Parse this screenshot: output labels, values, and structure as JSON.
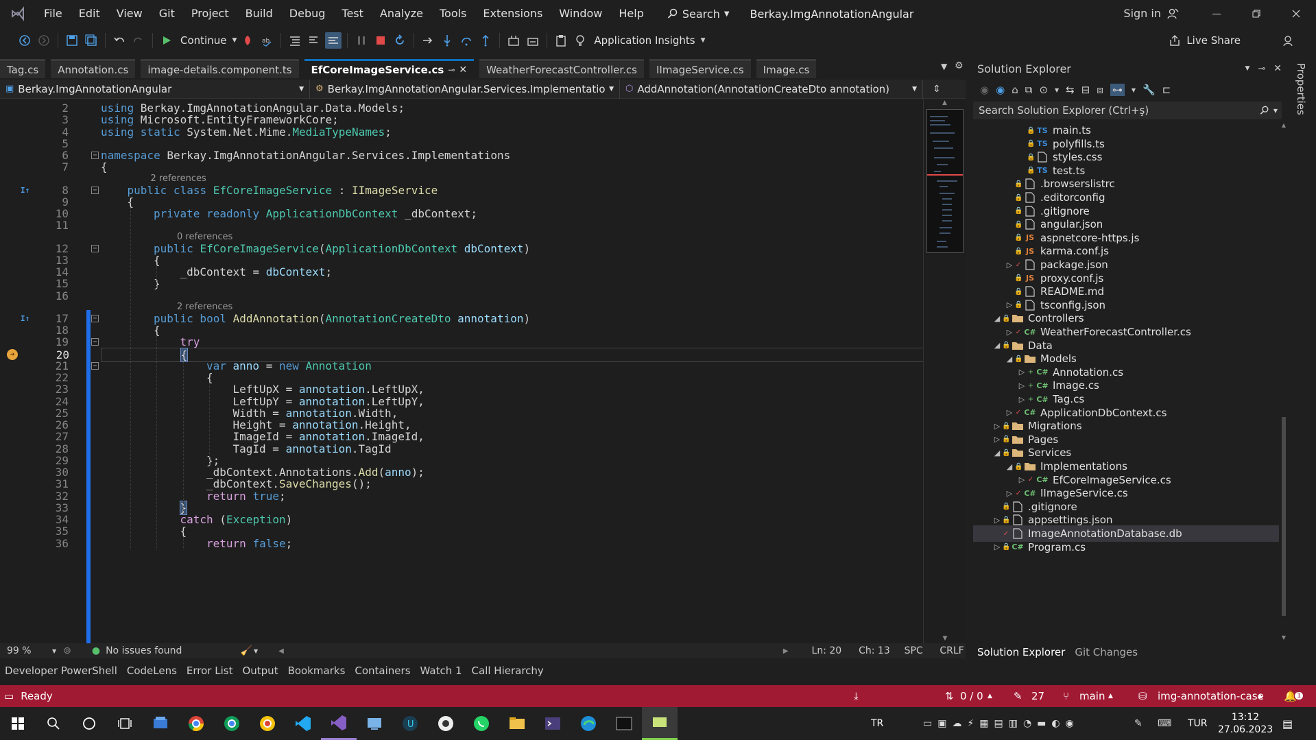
{
  "menubar": {
    "items": [
      "File",
      "Edit",
      "View",
      "Git",
      "Project",
      "Build",
      "Debug",
      "Test",
      "Analyze",
      "Tools",
      "Extensions",
      "Window",
      "Help"
    ],
    "search_label": "Search",
    "solution_name": "Berkay.ImgAnnotationAngular",
    "signin_label": "Sign in"
  },
  "toolbar": {
    "continue_label": "Continue",
    "app_insights_label": "Application Insights",
    "live_share_label": "Live Share"
  },
  "tabs": [
    {
      "label": "Tag.cs",
      "active": false
    },
    {
      "label": "Annotation.cs",
      "active": false
    },
    {
      "label": "image-details.component.ts",
      "active": false
    },
    {
      "label": "EfCoreImageService.cs",
      "active": true
    },
    {
      "label": "WeatherForecastController.cs",
      "active": false
    },
    {
      "label": "IImageService.cs",
      "active": false
    },
    {
      "label": "Image.cs",
      "active": false
    }
  ],
  "navbar": {
    "project": "Berkay.ImgAnnotationAngular",
    "type": "Berkay.ImgAnnotationAngular.Services.Implementations.EfCc",
    "member": "AddAnnotation(AnnotationCreateDto annotation)"
  },
  "editor": {
    "current_line": 20,
    "lines": [
      {
        "n": 2,
        "indent": 0,
        "tokens": [
          [
            "kw",
            "using "
          ],
          [
            "ns",
            "Berkay.ImgAnnotationAngular.Data.Models;"
          ]
        ]
      },
      {
        "n": 3,
        "indent": 0,
        "tokens": [
          [
            "kw",
            "using "
          ],
          [
            "ns",
            "Microsoft.EntityFrameworkCore;"
          ]
        ]
      },
      {
        "n": 4,
        "indent": 0,
        "tokens": [
          [
            "kw",
            "using static "
          ],
          [
            "ns",
            "System.Net.Mime."
          ],
          [
            "ty",
            "MediaTypeNames"
          ],
          [
            "pl",
            ";"
          ]
        ]
      },
      {
        "n": 5,
        "indent": 0,
        "tokens": []
      },
      {
        "n": 6,
        "indent": 0,
        "tokens": [
          [
            "kw",
            "namespace "
          ],
          [
            "ns",
            "Berkay.ImgAnnotationAngular.Services.Implementations"
          ]
        ]
      },
      {
        "n": 7,
        "indent": 0,
        "tokens": [
          [
            "pl",
            "{"
          ]
        ]
      },
      {
        "n": 8,
        "indent": 1,
        "lens": "2 references",
        "tokens": [
          [
            "kw",
            "public class "
          ],
          [
            "ty",
            "EfCoreImageService"
          ],
          [
            "pl",
            " : "
          ],
          [
            "fn",
            "IImageService"
          ]
        ]
      },
      {
        "n": 9,
        "indent": 1,
        "tokens": [
          [
            "pl",
            "{"
          ]
        ]
      },
      {
        "n": 10,
        "indent": 2,
        "tokens": [
          [
            "kw",
            "private readonly "
          ],
          [
            "ty",
            "ApplicationDbContext"
          ],
          [
            "pl",
            " _dbContext;"
          ]
        ]
      },
      {
        "n": 11,
        "indent": 0,
        "tokens": []
      },
      {
        "n": 12,
        "indent": 2,
        "lens": "0 references",
        "tokens": [
          [
            "kw",
            "public "
          ],
          [
            "ty",
            "EfCoreImageService"
          ],
          [
            "pl",
            "("
          ],
          [
            "ty",
            "ApplicationDbContext"
          ],
          [
            "pl",
            " "
          ],
          [
            "pa",
            "dbContext"
          ],
          [
            "pl",
            ")"
          ]
        ]
      },
      {
        "n": 13,
        "indent": 2,
        "tokens": [
          [
            "pl",
            "{"
          ]
        ]
      },
      {
        "n": 14,
        "indent": 3,
        "tokens": [
          [
            "pl",
            "_dbContext = "
          ],
          [
            "pa",
            "dbContext"
          ],
          [
            "pl",
            ";"
          ]
        ]
      },
      {
        "n": 15,
        "indent": 2,
        "tokens": [
          [
            "pl",
            "}"
          ]
        ]
      },
      {
        "n": 16,
        "indent": 0,
        "tokens": []
      },
      {
        "n": 17,
        "indent": 2,
        "lens": "2 references",
        "tokens": [
          [
            "kw",
            "public bool "
          ],
          [
            "fn",
            "AddAnnotation"
          ],
          [
            "pl",
            "("
          ],
          [
            "ty",
            "AnnotationCreateDto"
          ],
          [
            "pl",
            " "
          ],
          [
            "pa",
            "annotation"
          ],
          [
            "pl",
            ")"
          ]
        ]
      },
      {
        "n": 18,
        "indent": 2,
        "tokens": [
          [
            "pl",
            "{"
          ]
        ]
      },
      {
        "n": 19,
        "indent": 3,
        "tokens": [
          [
            "ctl",
            "try"
          ]
        ]
      },
      {
        "n": 20,
        "indent": 3,
        "tokens": [
          [
            "pl",
            "{"
          ]
        ]
      },
      {
        "n": 21,
        "indent": 4,
        "tokens": [
          [
            "kw",
            "var "
          ],
          [
            "pa",
            "anno"
          ],
          [
            "pl",
            " = "
          ],
          [
            "kw",
            "new "
          ],
          [
            "ty",
            "Annotation"
          ]
        ]
      },
      {
        "n": 22,
        "indent": 4,
        "tokens": [
          [
            "pl",
            "{"
          ]
        ]
      },
      {
        "n": 23,
        "indent": 5,
        "tokens": [
          [
            "pl",
            "LeftUpX = "
          ],
          [
            "pa",
            "annotation"
          ],
          [
            "pl",
            ".LeftUpX,"
          ]
        ]
      },
      {
        "n": 24,
        "indent": 5,
        "tokens": [
          [
            "pl",
            "LeftUpY = "
          ],
          [
            "pa",
            "annotation"
          ],
          [
            "pl",
            ".LeftUpY,"
          ]
        ]
      },
      {
        "n": 25,
        "indent": 5,
        "tokens": [
          [
            "pl",
            "Width = "
          ],
          [
            "pa",
            "annotation"
          ],
          [
            "pl",
            ".Width,"
          ]
        ]
      },
      {
        "n": 26,
        "indent": 5,
        "tokens": [
          [
            "pl",
            "Height = "
          ],
          [
            "pa",
            "annotation"
          ],
          [
            "pl",
            ".Height,"
          ]
        ]
      },
      {
        "n": 27,
        "indent": 5,
        "tokens": [
          [
            "pl",
            "ImageId = "
          ],
          [
            "pa",
            "annotation"
          ],
          [
            "pl",
            ".ImageId,"
          ]
        ]
      },
      {
        "n": 28,
        "indent": 5,
        "tokens": [
          [
            "pl",
            "TagId = "
          ],
          [
            "pa",
            "annotation"
          ],
          [
            "pl",
            ".TagId"
          ]
        ]
      },
      {
        "n": 29,
        "indent": 4,
        "tokens": [
          [
            "pl",
            "};"
          ]
        ]
      },
      {
        "n": 30,
        "indent": 4,
        "tokens": [
          [
            "pl",
            "_dbContext.Annotations."
          ],
          [
            "fn",
            "Add"
          ],
          [
            "pl",
            "("
          ],
          [
            "pa",
            "anno"
          ],
          [
            "pl",
            ");"
          ]
        ]
      },
      {
        "n": 31,
        "indent": 4,
        "tokens": [
          [
            "pl",
            "_dbContext."
          ],
          [
            "fn",
            "SaveChanges"
          ],
          [
            "pl",
            "();"
          ]
        ]
      },
      {
        "n": 32,
        "indent": 4,
        "tokens": [
          [
            "ctl",
            "return "
          ],
          [
            "kw",
            "true"
          ],
          [
            "pl",
            ";"
          ]
        ]
      },
      {
        "n": 33,
        "indent": 3,
        "tokens": [
          [
            "pl",
            "}"
          ]
        ]
      },
      {
        "n": 34,
        "indent": 3,
        "tokens": [
          [
            "ctl",
            "catch "
          ],
          [
            "pl",
            "("
          ],
          [
            "ty",
            "Exception"
          ],
          [
            "pl",
            ")"
          ]
        ]
      },
      {
        "n": 35,
        "indent": 3,
        "tokens": [
          [
            "pl",
            "{"
          ]
        ]
      },
      {
        "n": 36,
        "indent": 4,
        "tokens": [
          [
            "ctl",
            "return "
          ],
          [
            "kw",
            "false"
          ],
          [
            "pl",
            ";"
          ]
        ]
      }
    ]
  },
  "statusline": {
    "zoom": "99 %",
    "issues": "No issues found",
    "line": "Ln: 20",
    "col": "Ch: 13",
    "spacing": "SPC",
    "eol": "CRLF"
  },
  "bottom_tabs": [
    "Developer PowerShell",
    "CodeLens",
    "Error List",
    "Output",
    "Bookmarks",
    "Containers",
    "Watch 1",
    "Call Hierarchy"
  ],
  "statusbar": {
    "ready": "Ready",
    "updown": "0 / 0",
    "pencil_count": "27",
    "branch": "main",
    "repo": "img-annotation-case",
    "notifications": "1"
  },
  "solution_explorer": {
    "title": "Solution Explorer",
    "search_placeholder": "Search Solution Explorer (Ctrl+ş)",
    "tree": [
      {
        "label": "main.ts",
        "depth": 4,
        "expand": "",
        "icon": "TS",
        "iconColor": "#3b8ede"
      },
      {
        "label": "polyfills.ts",
        "depth": 4,
        "expand": "",
        "icon": "TS",
        "iconColor": "#3b8ede"
      },
      {
        "label": "styles.css",
        "depth": 4,
        "expand": "",
        "icon": "css",
        "iconColor": "#c8503c"
      },
      {
        "label": "test.ts",
        "depth": 4,
        "expand": "",
        "icon": "TS",
        "iconColor": "#3b8ede"
      },
      {
        "label": ".browserslistrc",
        "depth": 3,
        "expand": "",
        "icon": "file",
        "iconColor": "#cccccc"
      },
      {
        "label": ".editorconfig",
        "depth": 3,
        "expand": "",
        "icon": "file",
        "iconColor": "#cccccc"
      },
      {
        "label": ".gitignore",
        "depth": 3,
        "expand": "",
        "icon": "file",
        "iconColor": "#cccccc"
      },
      {
        "label": "angular.json",
        "depth": 3,
        "expand": "",
        "icon": "json",
        "iconColor": "#cccccc"
      },
      {
        "label": "aspnetcore-https.js",
        "depth": 3,
        "expand": "",
        "icon": "JS",
        "iconColor": "#e0803c"
      },
      {
        "label": "karma.conf.js",
        "depth": 3,
        "expand": "",
        "icon": "JS",
        "iconColor": "#e0803c"
      },
      {
        "label": "package.json",
        "depth": 3,
        "expand": "right",
        "icon": "json",
        "iconColor": "#cccccc",
        "check": true
      },
      {
        "label": "proxy.conf.js",
        "depth": 3,
        "expand": "",
        "icon": "JS",
        "iconColor": "#e0803c"
      },
      {
        "label": "README.md",
        "depth": 3,
        "expand": "",
        "icon": "md",
        "iconColor": "#cccccc"
      },
      {
        "label": "tsconfig.json",
        "depth": 3,
        "expand": "right",
        "icon": "json",
        "iconColor": "#cccccc"
      },
      {
        "label": "Controllers",
        "depth": 2,
        "expand": "down",
        "icon": "folder",
        "iconColor": "#dcb67a"
      },
      {
        "label": "WeatherForecastController.cs",
        "depth": 3,
        "expand": "right",
        "icon": "C#",
        "iconColor": "#6fbf73",
        "check": true
      },
      {
        "label": "Data",
        "depth": 2,
        "expand": "down",
        "icon": "folder",
        "iconColor": "#dcb67a"
      },
      {
        "label": "Models",
        "depth": 3,
        "expand": "down",
        "icon": "folder",
        "iconColor": "#dcb67a"
      },
      {
        "label": "Annotation.cs",
        "depth": 4,
        "expand": "right",
        "icon": "C#",
        "iconColor": "#6fbf73",
        "plus": true
      },
      {
        "label": "Image.cs",
        "depth": 4,
        "expand": "right",
        "icon": "C#",
        "iconColor": "#6fbf73",
        "plus": true
      },
      {
        "label": "Tag.cs",
        "depth": 4,
        "expand": "right",
        "icon": "C#",
        "iconColor": "#6fbf73",
        "plus": true
      },
      {
        "label": "ApplicationDbContext.cs",
        "depth": 3,
        "expand": "right",
        "icon": "C#",
        "iconColor": "#6fbf73",
        "check": true
      },
      {
        "label": "Migrations",
        "depth": 2,
        "expand": "right",
        "icon": "folder",
        "iconColor": "#dcb67a"
      },
      {
        "label": "Pages",
        "depth": 2,
        "expand": "right",
        "icon": "folder",
        "iconColor": "#dcb67a"
      },
      {
        "label": "Services",
        "depth": 2,
        "expand": "down",
        "icon": "folder",
        "iconColor": "#dcb67a"
      },
      {
        "label": "Implementations",
        "depth": 3,
        "expand": "down",
        "icon": "folder",
        "iconColor": "#dcb67a"
      },
      {
        "label": "EfCoreImageService.cs",
        "depth": 4,
        "expand": "right",
        "icon": "C#",
        "iconColor": "#6fbf73",
        "check": true
      },
      {
        "label": "IImageService.cs",
        "depth": 3,
        "expand": "right",
        "icon": "C#",
        "iconColor": "#6fbf73",
        "check": true
      },
      {
        "label": ".gitignore",
        "depth": 2,
        "expand": "",
        "icon": "file",
        "iconColor": "#cccccc"
      },
      {
        "label": "appsettings.json",
        "depth": 2,
        "expand": "right",
        "icon": "json",
        "iconColor": "#cccccc"
      },
      {
        "label": "ImageAnnotationDatabase.db",
        "depth": 2,
        "expand": "",
        "icon": "file",
        "iconColor": "#cccccc",
        "selected": true,
        "check": true
      },
      {
        "label": "Program.cs",
        "depth": 2,
        "expand": "right",
        "icon": "C#",
        "iconColor": "#6fbf73"
      }
    ],
    "bottom_tabs": [
      "Solution Explorer",
      "Git Changes"
    ]
  },
  "properties_label": "Properties",
  "taskbar": {
    "lang": "TR",
    "kbd": "TUR",
    "time": "13:12",
    "date": "27.06.2023"
  }
}
